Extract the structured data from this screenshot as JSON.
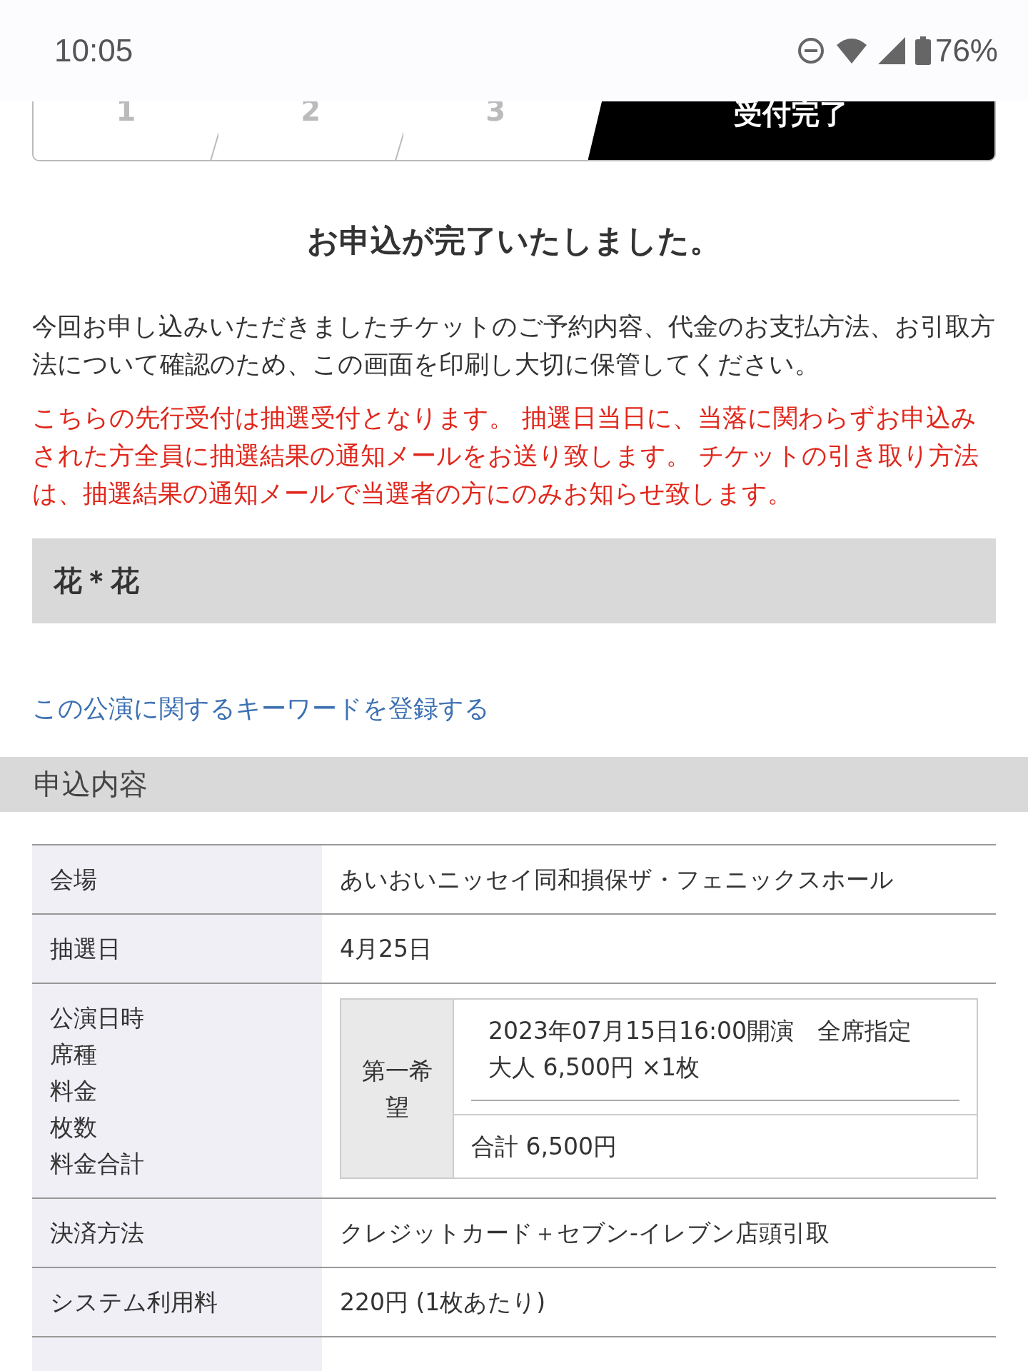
{
  "status_bar": {
    "time": "10:05",
    "battery": "76%"
  },
  "steps": [
    {
      "label": "1",
      "selected": false
    },
    {
      "label": "2",
      "selected": false
    },
    {
      "label": "3",
      "selected": false
    },
    {
      "label": "受付完了",
      "selected": true
    }
  ],
  "title": "お申込が完了いたしました。",
  "intro": "今回お申し込みいただきましたチケットのご予約内容、代金のお支払方法、お引取方法について確認のため、この画面を印刷し大切に保管してください。",
  "notice": "こちらの先行受付は抽選受付となります。 抽選日当日に、当落に関わらずお申込みされた方全員に抽選結果の通知メールをお送り致します。 チケットの引き取り方法は、抽選結果の通知メールで当選者の方にのみお知らせ致します。",
  "performer": "花＊花",
  "keyword_link": "この公演に関するキーワードを登録する",
  "section_title": "申込内容",
  "rows": [
    {
      "kind": "text",
      "labels": [
        "会場"
      ],
      "value": "あいおいニッセイ同和損保ザ・フェニックスホール"
    },
    {
      "kind": "text",
      "labels": [
        "抽選日"
      ],
      "value": "4月25日"
    },
    {
      "kind": "choice",
      "labels": [
        "公演日時",
        "席種",
        "料金",
        "枚数",
        "料金合計"
      ],
      "choice": {
        "rank": "第一希望",
        "lines": [
          "2023年07月15日16:00開演　全席指定",
          "大人 6,500円 ×1枚"
        ],
        "total": "合計 6,500円"
      }
    },
    {
      "kind": "text",
      "labels": [
        "決済方法"
      ],
      "value": "クレジットカード＋セブン-イレブン店頭引取"
    },
    {
      "kind": "text",
      "labels": [
        "システム利用料"
      ],
      "value": "220円 (1枚あたり)"
    }
  ]
}
